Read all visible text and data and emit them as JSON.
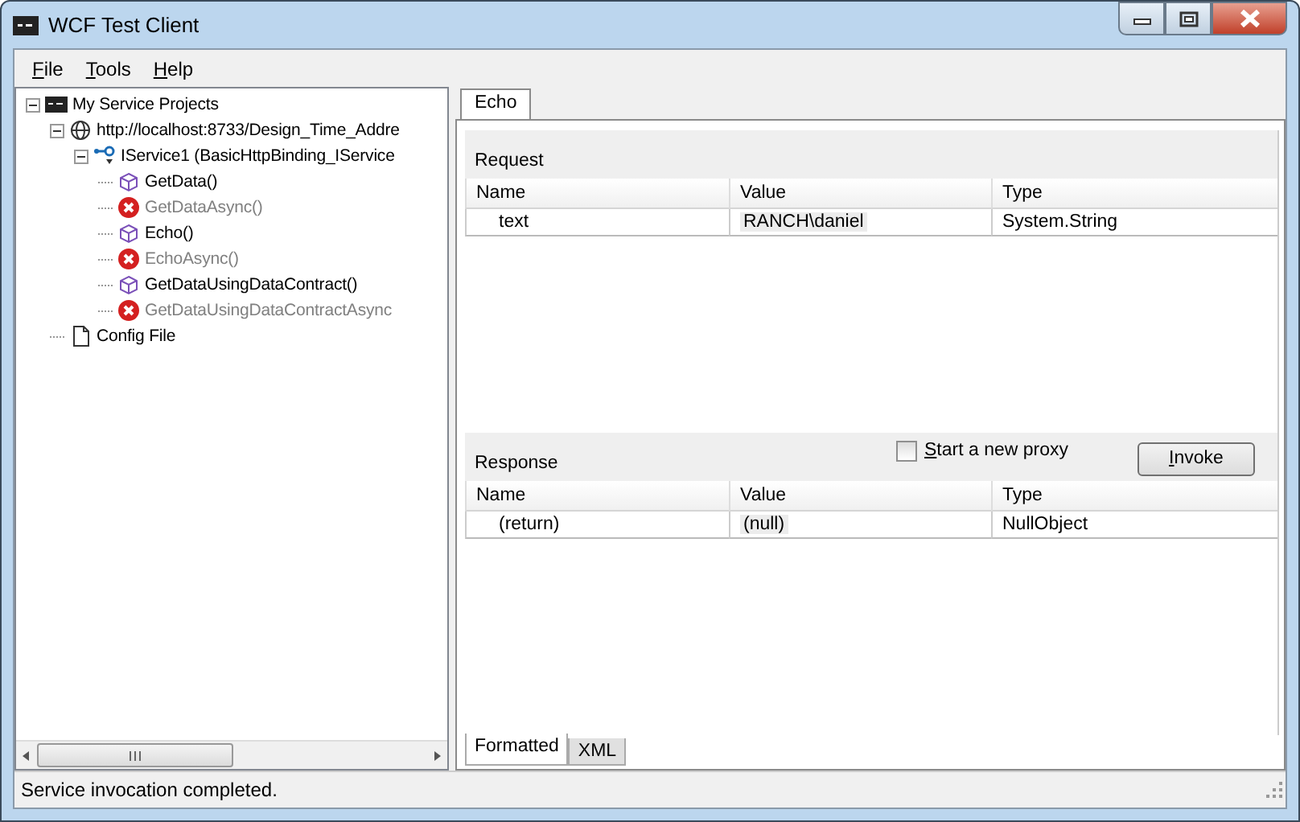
{
  "window": {
    "title": "WCF Test Client"
  },
  "menu": [
    "File",
    "Tools",
    "Help"
  ],
  "tree": [
    {
      "kind": "project",
      "label": "My Service Projects",
      "expanded": true,
      "children": [
        {
          "kind": "endpoint",
          "label": "http://localhost:8733/Design_Time_Addre",
          "expanded": true,
          "children": [
            {
              "kind": "contract",
              "label": "IService1 (BasicHttpBinding_IService",
              "expanded": true,
              "children": [
                {
                  "kind": "operation",
                  "label": "GetData()"
                },
                {
                  "kind": "unsupported",
                  "label": "GetDataAsync()"
                },
                {
                  "kind": "operation",
                  "label": "Echo()"
                },
                {
                  "kind": "unsupported",
                  "label": "EchoAsync()"
                },
                {
                  "kind": "operation",
                  "label": "GetDataUsingDataContract()"
                },
                {
                  "kind": "unsupported",
                  "label": "GetDataUsingDataContractAsync"
                }
              ]
            }
          ]
        },
        {
          "kind": "file",
          "label": "Config File"
        }
      ]
    }
  ],
  "tabs": [
    {
      "label": "Echo",
      "selected": true
    }
  ],
  "request": {
    "title": "Request",
    "columns": [
      "Name",
      "Value",
      "Type"
    ],
    "rows": [
      {
        "name": "text",
        "value": "RANCH\\daniel",
        "type": "System.String"
      }
    ]
  },
  "response": {
    "title": "Response",
    "new_proxy": {
      "label": "Start a new proxy",
      "checked": false
    },
    "invoke": "Invoke",
    "columns": [
      "Name",
      "Value",
      "Type"
    ],
    "rows": [
      {
        "name": "(return)",
        "value": "(null)",
        "type": "NullObject"
      }
    ]
  },
  "view_tabs": [
    {
      "label": "Formatted",
      "selected": true
    },
    {
      "label": "XML",
      "selected": false
    }
  ],
  "status_bar": "Service invocation completed."
}
